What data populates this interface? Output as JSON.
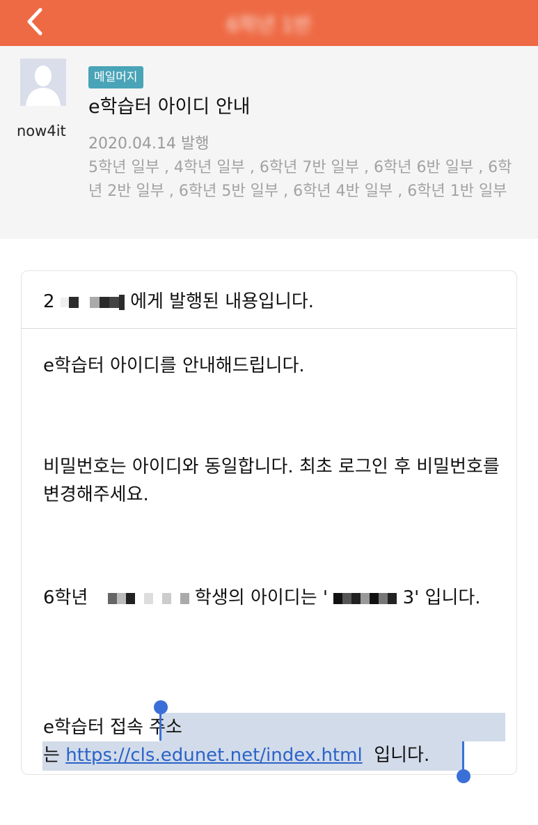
{
  "topbar": {
    "title": "6학년 1반"
  },
  "header": {
    "author": "now4it",
    "badge": "메일머지",
    "subject": "e학습터 아이디 안내",
    "date": "2020.04.14 발행",
    "targets": "5학년 일부 , 4학년 일부 , 6학년 7반 일부 , 6학년 6반 일부 , 6학년 2반 일부 , 6학년 5반 일부 , 6학년 4반 일부 , 6학년 1반 일부"
  },
  "body": {
    "recipient_prefix": "2",
    "recipient_suffix": "에게 발행된 내용입니다.",
    "p1": "e학습터 아이디를 안내해드립니다.",
    "p2": "비밀번호는 아이디와 동일합니다. 최초 로그인 후 비밀번호를 변경해주세요.",
    "p3_prefix": "6학년",
    "p3_mid": "학생의 아이디는 '",
    "p3_mid2": "3' 입니다.",
    "p4_prefix": "e학습터 접속 ",
    "p4_mid": "주소",
    "p4_line2_prefix": "는 ",
    "p4_link": "https://cls.edunet.net/index.html",
    "p4_suffix": "  입니다."
  },
  "colors": {
    "accent": "#ee6a44",
    "badge": "#4aa4b8",
    "link": "#2a63c9",
    "selection": "#d2dbe9"
  },
  "icons": {
    "back": "chevron-left-icon",
    "avatar": "default-avatar-icon"
  }
}
